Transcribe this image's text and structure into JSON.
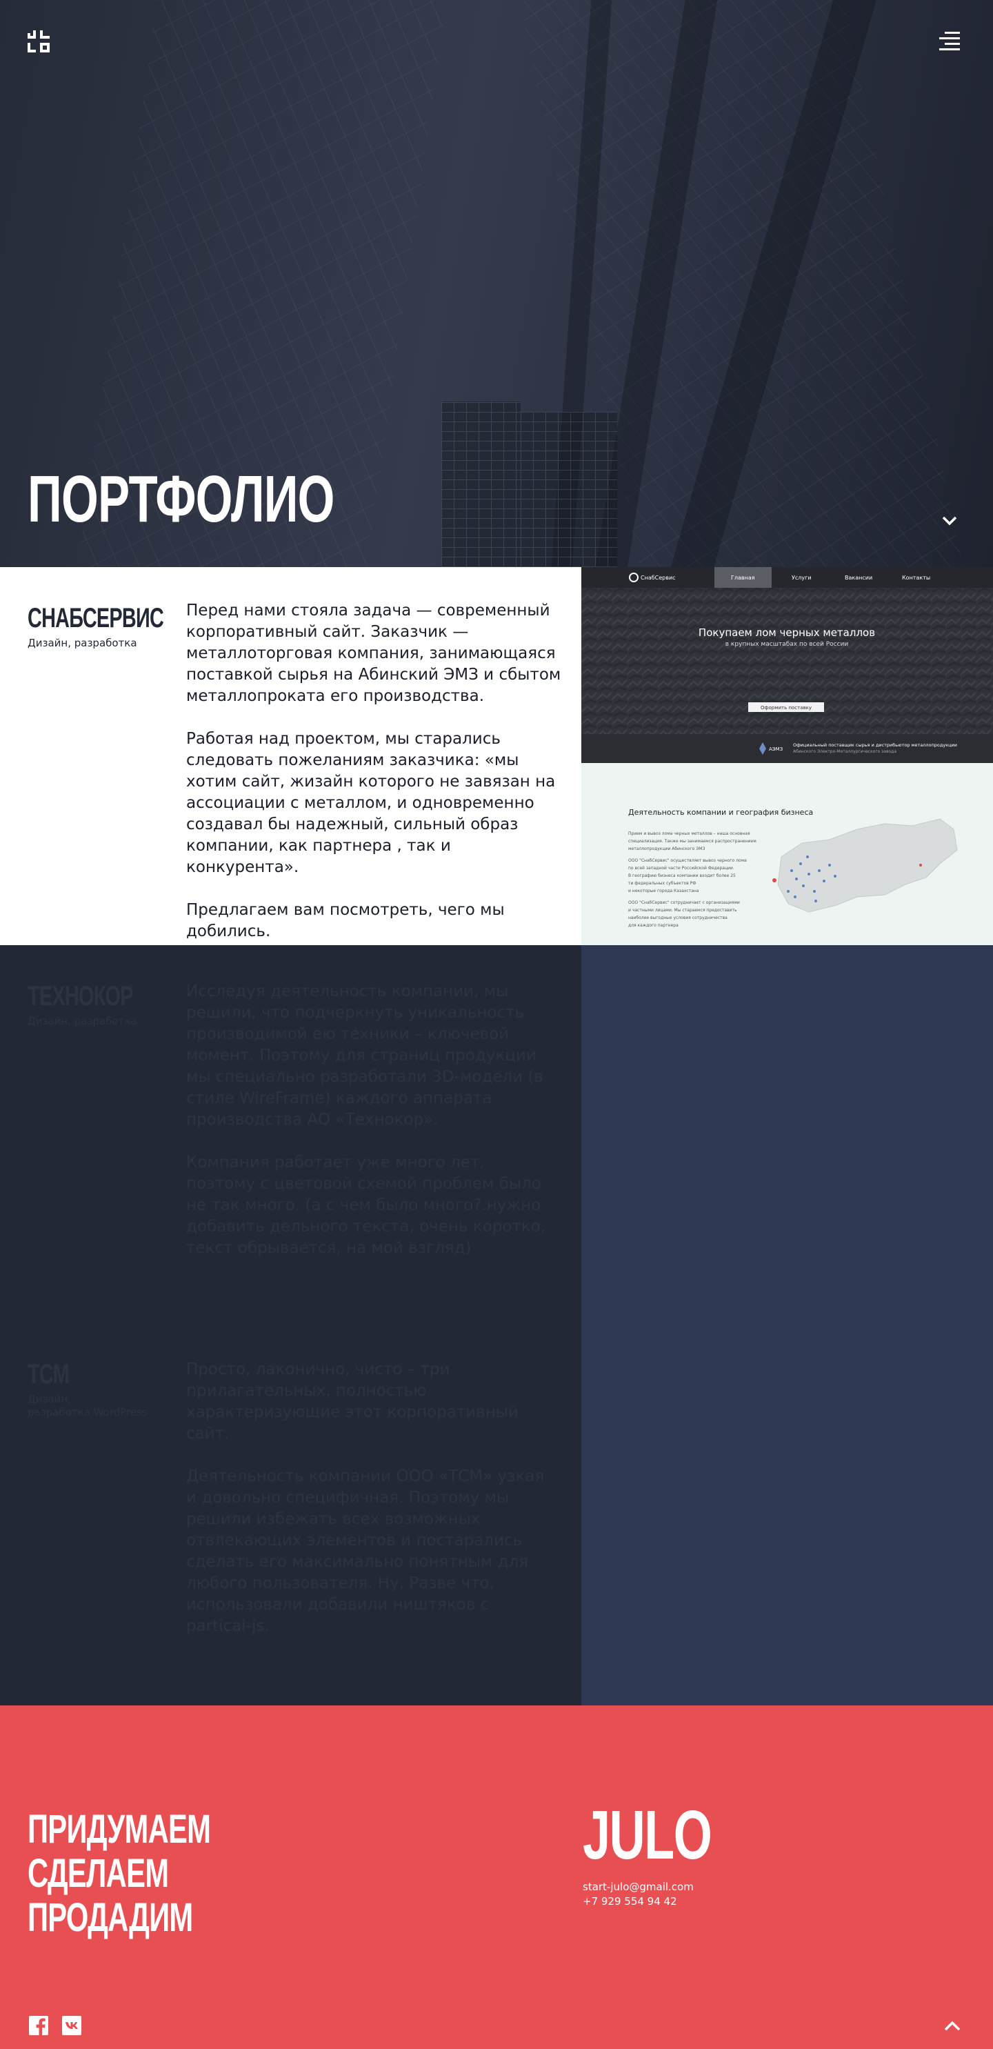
{
  "hero": {
    "title": "ПОРТФОЛИО"
  },
  "projects": [
    {
      "name": "СНАБСЕРВИС",
      "subtitle": "Дизайн, разработка",
      "paragraphs": [
        "Перед нами стояла задача — современный корпоративный сайт.  Заказчик — металлоторговая компания, занимающаяся поставкой сырья на Абинский ЭМЗ и сбытом металлопроката его производства.",
        "Работая над проектом, мы старались следовать пожеланиям заказчика: «мы хотим сайт, жизайн которого не завязан на ассоциации с металлом, и одновременно создавал бы надежный, сильный образ компании, как партнера , так и конкурента».",
        "Предлагаем вам  посмотреть, чего мы добились."
      ]
    },
    {
      "name": "ТЕХНОКОР",
      "subtitle": "Дизайн, разработка",
      "paragraphs": [
        "Исследуя деятельность компании, мы решили, что подчеркнуть уникальность производимой ею техники – ключевой момент. Поэтому для страниц продукции мы специально разработали 3D-модели (в стиле WireFrame) каждого аппарата производства АО «Технокор».",
        "Компания работает уже много лет, поэтому с цветовой схемой проблем было не так много. (а с чем было много?.нужно добавить дельного текста, очень коротко, текст обрывается, на мой взгляд)"
      ]
    },
    {
      "name": "ТСМ",
      "subtitle_lines": [
        "Дизайн,",
        "разработка WordPress"
      ],
      "paragraphs": [
        "Просто, лаконично, чисто – три прилагательных, полностью характеризующие этот корпоративный сайт.",
        "Деятельность компании ООО «ТСМ» узкая и довольно специфичная.  Поэтому мы решили избежать всех возможных отвлекающих элементов и постарались сделать его максимально понятным для любого пользователя. Ну, Разве что, использовали добавили ништяков с partical-js."
      ]
    }
  ],
  "screenshot": {
    "brand": "СнабСервис",
    "nav": [
      "Главная",
      "Услуги",
      "Вакансии",
      "Контакты"
    ],
    "hero_title": "Покупаем лом черных металлов",
    "hero_sub": "в крупных масштабах по всей России",
    "cta": "Оформить поставку",
    "partner_logo": "АЭМЗ",
    "partner_text_1": "Официальный поставщик сырья и дистрибьютор металлопродукции",
    "partner_text_2": "Абинского Электро-Металлургического завода",
    "section_title": "Деятельность компании и география бизнеса",
    "section_lines": [
      "Прием и вывоз лома черных металлов – наша основная",
      "специализация. Также мы занимаемся распространением",
      "металлопродукции Абинского ЭМЗ",
      "",
      "ООО \"СнабСервис\" осуществляет вывоз черного лома",
      "по всей западной части Российской Федерации.",
      "В географию бизнеса компании входит более 25",
      "ти федеральных субъектов РФ",
      "и некоторые города Казахстана",
      "",
      "ООО \"СнабСервис\" сотрудничает с организациями",
      "и частными лицами. Мы стараемся предоставить",
      "наиболее выгодные условия сотрудничества",
      "для каждого партнера"
    ]
  },
  "footer": {
    "slogan": [
      "ПРИДУМАЕМ",
      "СДЕЛАЕМ",
      "ПРОДАДИМ"
    ],
    "brand": "JULO",
    "email": "start-julo@gmail.com",
    "phone": "+7 929 554 94 42"
  },
  "icons": {
    "logo": "julo-logo-icon",
    "menu": "hamburger-menu-icon",
    "scroll_down": "chevron-down-icon",
    "scroll_top": "chevron-up-icon",
    "social": [
      "facebook-icon",
      "vk-icon"
    ]
  },
  "colors": {
    "hero_bg": "#2b3040",
    "dark_bg": "#222836",
    "panel_bg": "#2f3852",
    "footer_bg": "#e84f53",
    "faded_text": "#2c3342"
  }
}
